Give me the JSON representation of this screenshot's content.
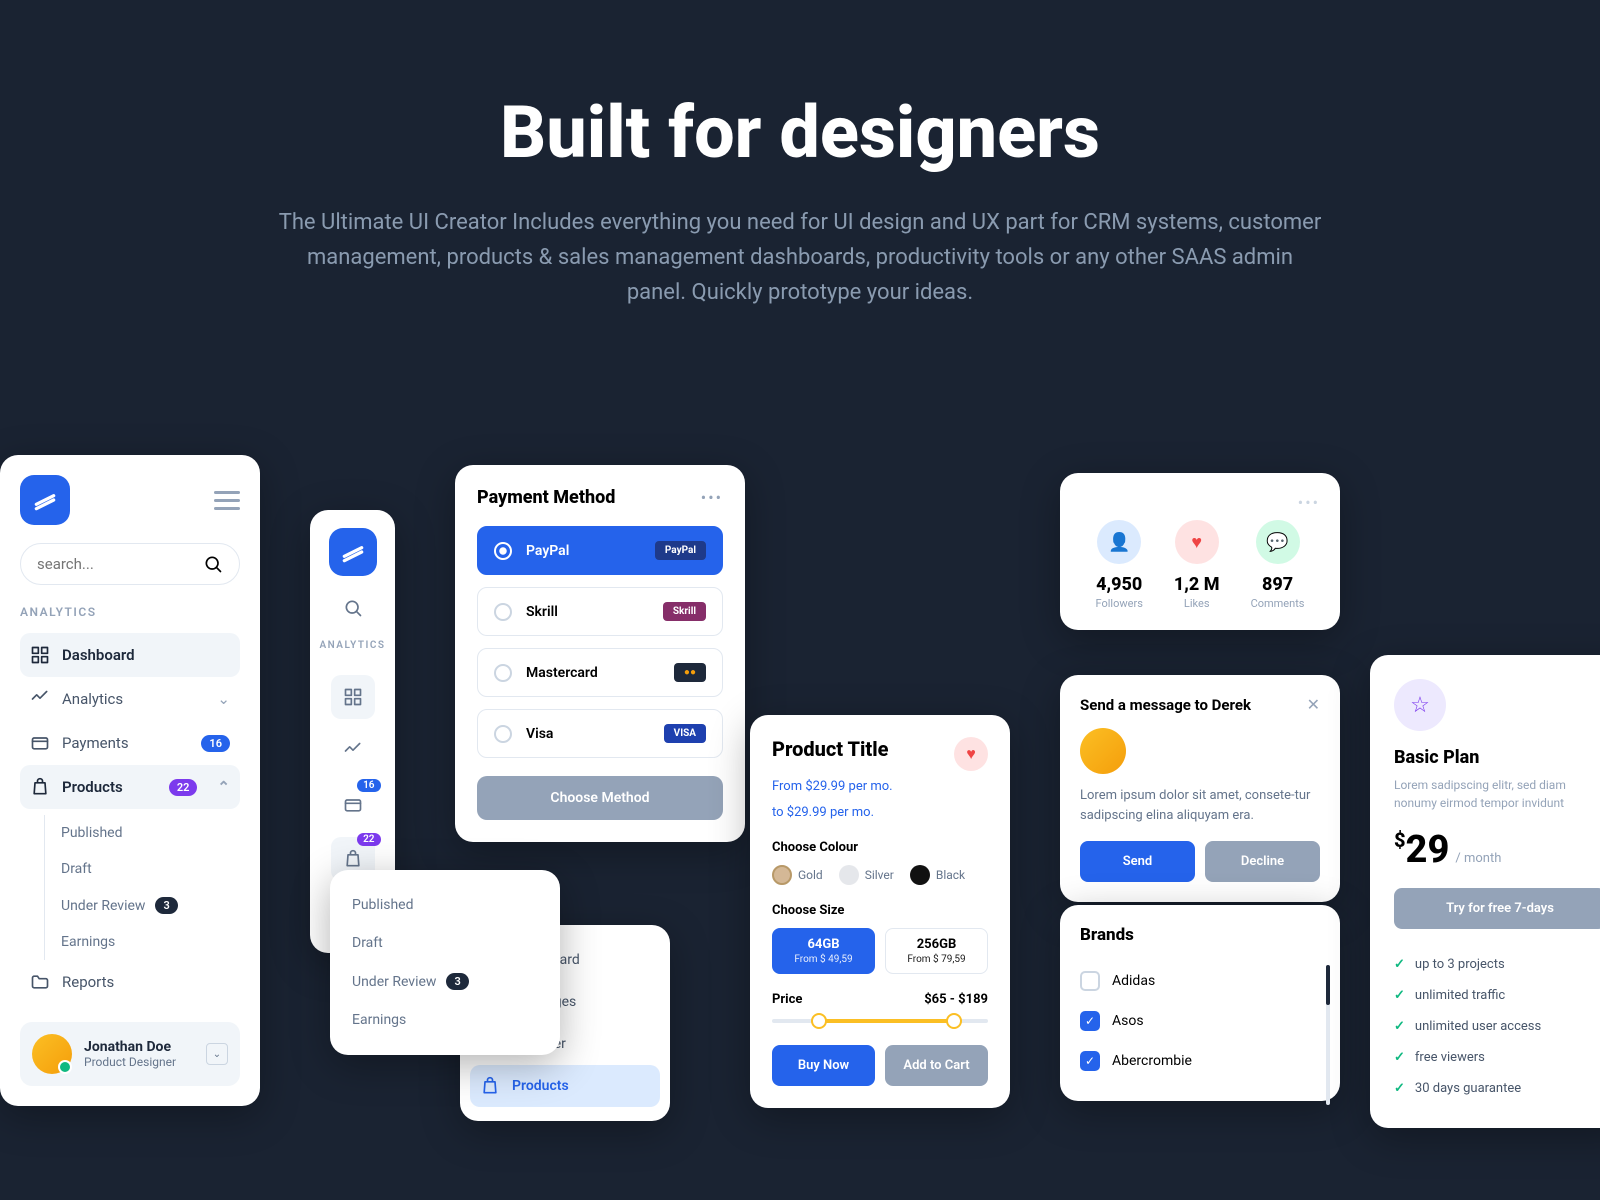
{
  "hero": {
    "title": "Built for designers",
    "subtitle": "The Ultimate UI Creator Includes everything you need for UI design and UX part for CRM systems, customer management, products & sales management dashboards, productivity tools or any other SAAS admin panel. Quickly prototype your ideas."
  },
  "sidebar": {
    "search_placeholder": "search...",
    "section": "ANALYTICS",
    "items": [
      {
        "label": "Dashboard"
      },
      {
        "label": "Analytics"
      },
      {
        "label": "Payments",
        "badge": "16"
      },
      {
        "label": "Products",
        "badge": "22"
      }
    ],
    "sub_items": [
      "Published",
      "Draft",
      "Under Review",
      "Earnings"
    ],
    "under_review_badge": "3",
    "reports": "Reports",
    "profile": {
      "name": "Jonathan Doe",
      "role": "Product Designer"
    }
  },
  "sidebar2": {
    "section": "ANALYTICS",
    "badge1": "16",
    "badge2": "22"
  },
  "popup": {
    "items": [
      "Published",
      "Draft",
      "Under Review",
      "Earnings"
    ],
    "badge": "3"
  },
  "dashlist": {
    "items": [
      "Dashboard",
      "Messages",
      "Discover",
      "Products"
    ]
  },
  "payment": {
    "title": "Payment Method",
    "options": [
      {
        "name": "PayPal",
        "logo": "PayPal",
        "bg": "#1e3a8a"
      },
      {
        "name": "Skrill",
        "logo": "Skrill",
        "bg": "#862e69"
      },
      {
        "name": "Mastercard",
        "logo": "●●",
        "bg": "#1e293b"
      },
      {
        "name": "Visa",
        "logo": "VISA",
        "bg": "#1e40af"
      }
    ],
    "button": "Choose Method"
  },
  "product": {
    "title": "Product Title",
    "price_from": "From $29.99 per mo.",
    "price_to": "to $29.99 per mo.",
    "colour_label": "Choose Colour",
    "colours": [
      {
        "name": "Gold",
        "hex": "#d4b896"
      },
      {
        "name": "Silver",
        "hex": "#e5e7eb"
      },
      {
        "name": "Black",
        "hex": "#111"
      }
    ],
    "size_label": "Choose Size",
    "sizes": [
      {
        "cap": "64GB",
        "price": "From $ 49,59"
      },
      {
        "cap": "256GB",
        "price": "From $ 79,59"
      }
    ],
    "price_label": "Price",
    "price_range": "$65 - $189",
    "buy": "Buy Now",
    "cart": "Add to Cart"
  },
  "stats": {
    "items": [
      {
        "value": "4,950",
        "label": "Followers"
      },
      {
        "value": "1,2 M",
        "label": "Likes"
      },
      {
        "value": "897",
        "label": "Comments"
      }
    ]
  },
  "message": {
    "title": "Send a message to Derek",
    "text": "Lorem ipsum dolor sit amet, consete-tur sadipscing elina aliquyam era.",
    "send": "Send",
    "decline": "Decline"
  },
  "brands": {
    "title": "Brands",
    "items": [
      {
        "name": "Adidas",
        "checked": false
      },
      {
        "name": "Asos",
        "checked": true
      },
      {
        "name": "Abercrombie",
        "checked": true
      }
    ]
  },
  "pricing": {
    "name": "Basic Plan",
    "desc": "Lorem sadipscing elitr, sed diam nonumy eirmod tempor invidunt",
    "currency": "$",
    "amount": "29",
    "period": "/ month",
    "trial": "Try for free 7-days",
    "features": [
      "up to 3 projects",
      "unlimited traffic",
      "unlimited user access",
      "free viewers",
      "30 days guarantee"
    ]
  }
}
